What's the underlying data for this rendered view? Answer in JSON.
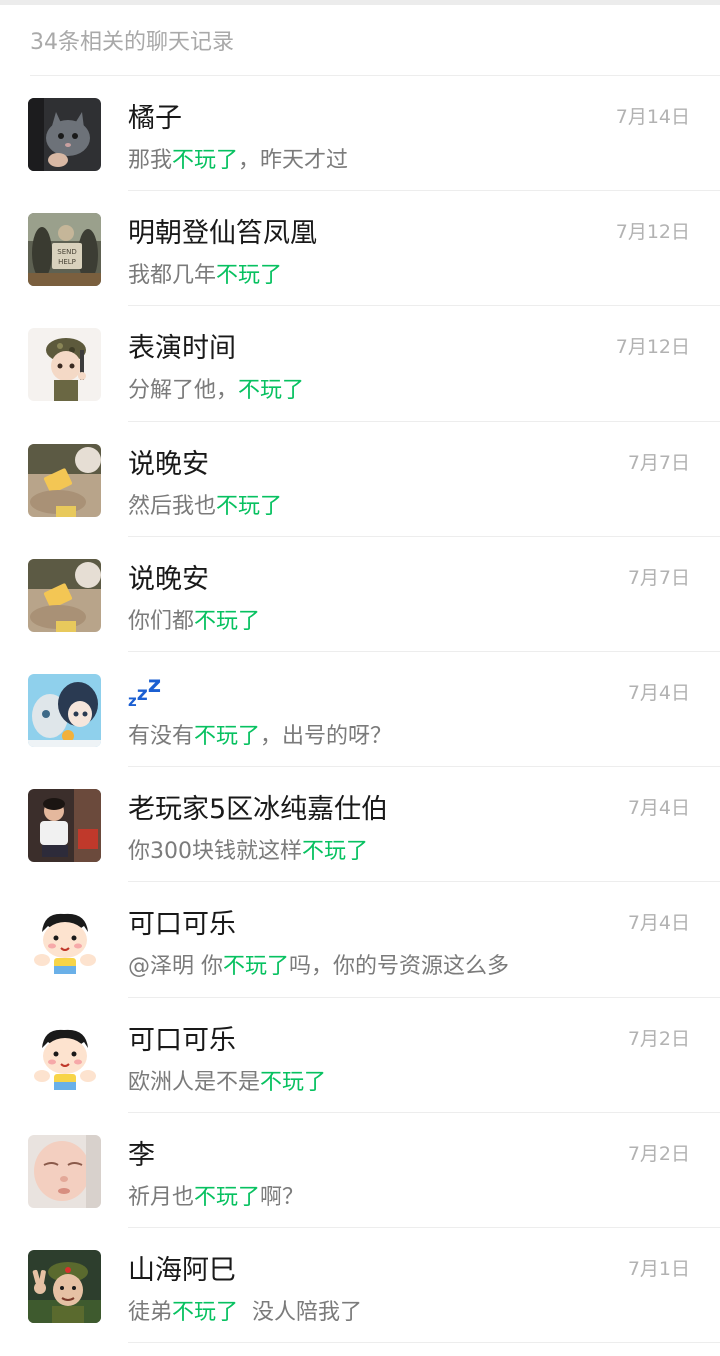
{
  "header": {
    "title": "34条相关的聊天记录"
  },
  "results": [
    {
      "name": "橘子",
      "date": "7月14日",
      "message": {
        "pre": "那我",
        "hl": "不玩了",
        "post": "，昨天才过"
      },
      "avatar": "cat-avatar"
    },
    {
      "name": "明朝登仙笞凤凰",
      "date": "7月12日",
      "message": {
        "pre": "我都几年",
        "hl": "不玩了",
        "post": ""
      },
      "avatar": "send-help-avatar",
      "avatar_text": "SEND HELP"
    },
    {
      "name": "表演时间",
      "date": "7月12日",
      "message": {
        "pre": "分解了他，",
        "hl": "不玩了",
        "post": ""
      },
      "avatar": "soldier-cartoon-avatar"
    },
    {
      "name": "说晚安",
      "date": "7月7日",
      "message": {
        "pre": "然后我也",
        "hl": "不玩了",
        "post": ""
      },
      "avatar": "phone-photo-avatar"
    },
    {
      "name": "说晚安",
      "date": "7月7日",
      "message": {
        "pre": "你们都",
        "hl": "不玩了",
        "post": ""
      },
      "avatar": "phone-photo-avatar"
    },
    {
      "name": "zzz",
      "date": "7月4日",
      "message": {
        "pre": "有没有",
        "hl": "不玩了",
        "post": "，出号的呀？"
      },
      "avatar": "anime-avatar"
    },
    {
      "name": "老玩家5区冰纯嘉仕伯",
      "date": "7月4日",
      "message": {
        "pre": "你300块钱就这样",
        "hl": "不玩了",
        "post": ""
      },
      "avatar": "child-photo-avatar"
    },
    {
      "name": "可口可乐",
      "date": "7月4日",
      "message": {
        "pre": "@泽明 你",
        "hl": "不玩了",
        "post": "吗，你的号资源这么多"
      },
      "avatar": "cartoon-boy-avatar"
    },
    {
      "name": "可口可乐",
      "date": "7月2日",
      "message": {
        "pre": "欧洲人是不是",
        "hl": "不玩了",
        "post": ""
      },
      "avatar": "cartoon-boy-avatar"
    },
    {
      "name": "李",
      "date": "7月2日",
      "message": {
        "pre": "祈月也",
        "hl": "不玩了",
        "post": "啊？"
      },
      "avatar": "baby-photo-avatar"
    },
    {
      "name": "山海阿巳",
      "date": "7月1日",
      "message": {
        "pre": "徒弟",
        "hl": "不玩了",
        "post": "  没人陪我了"
      },
      "avatar": "peace-sign-avatar"
    }
  ],
  "colors": {
    "highlight": "#07c160",
    "name": "#191919",
    "message": "#7b7b7b",
    "date": "#b2b2b2",
    "header": "#a9a9a9"
  }
}
